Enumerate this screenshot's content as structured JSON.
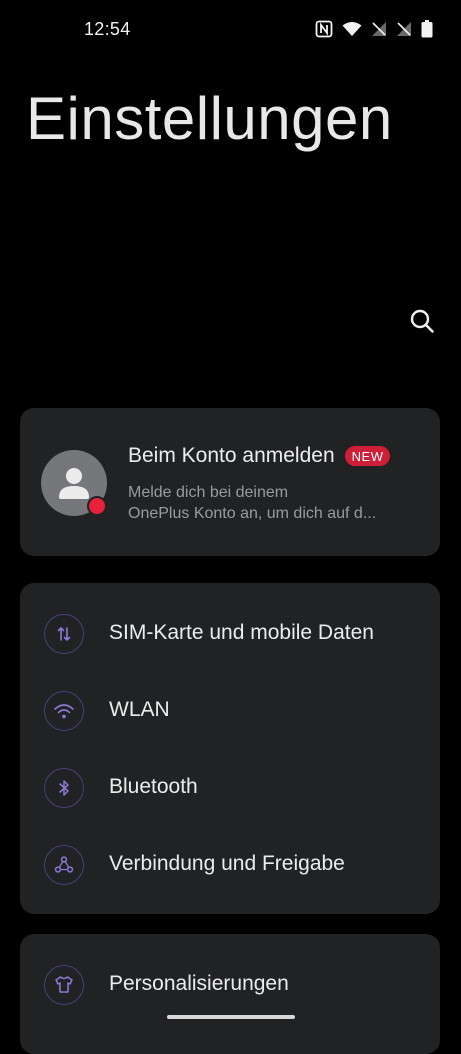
{
  "status_bar": {
    "time": "12:54",
    "icons": [
      "nfc-icon",
      "wifi-icon",
      "no-signal-icon",
      "no-signal-icon",
      "battery-icon"
    ]
  },
  "page": {
    "title": "Einstellungen"
  },
  "search": {
    "icon": "search-icon"
  },
  "account": {
    "title": "Beim Konto anmelden",
    "badge": "NEW",
    "subtitle_line1": "Melde dich bei deinem",
    "subtitle_line2": "OnePlus Konto an, um dich auf d...",
    "badge_color": "#cf1f38",
    "dot_color": "#e7213a"
  },
  "connections": {
    "items": [
      {
        "label": "SIM-Karte und mobile Daten",
        "icon": "sim-data-icon"
      },
      {
        "label": "WLAN",
        "icon": "wifi-icon"
      },
      {
        "label": "Bluetooth",
        "icon": "bluetooth-icon"
      },
      {
        "label": "Verbindung und Freigabe",
        "icon": "share-icon"
      }
    ]
  },
  "personalization": {
    "items": [
      {
        "label": "Personalisierungen",
        "icon": "shirt-icon"
      }
    ]
  },
  "colors": {
    "background": "#000000",
    "card": "#212224",
    "accent_icon": "#8e7ad6"
  }
}
